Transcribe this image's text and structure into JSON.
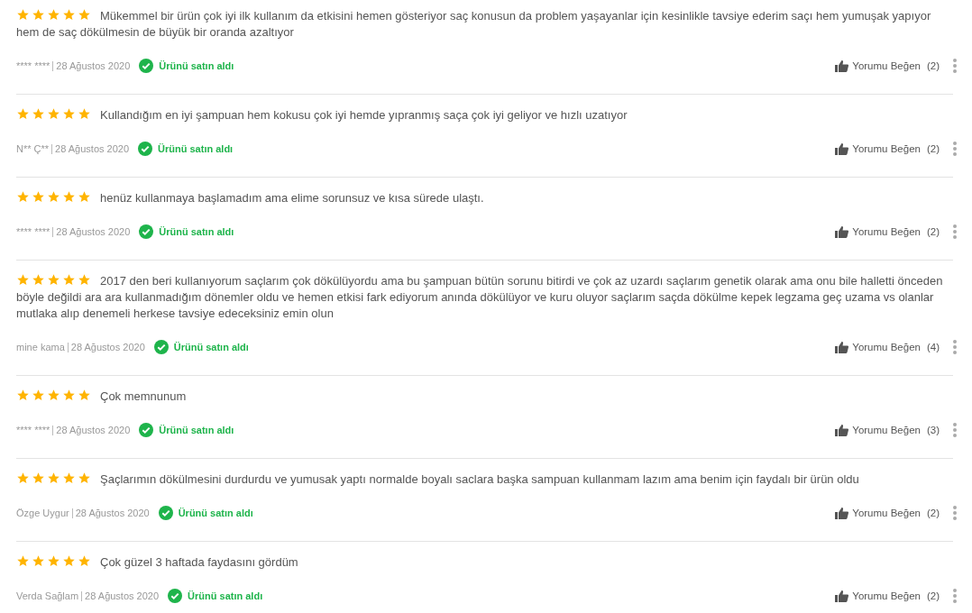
{
  "reviews": [
    {
      "stars": 5,
      "text": "Mükemmel bir ürün çok iyi ilk kullanım da etkisini hemen gösteriyor saç konusun da problem yaşayanlar için kesinlikle tavsiye ederim saçı hem yumuşak yapıyor hem de saç dökülmesin de büyük bir oranda azaltıyor",
      "author": "**** ****",
      "date": "28 Ağustos 2020",
      "verified": true,
      "badge": "Ürünü satın aldı",
      "like_label": "Yorumu Beğen",
      "like_count": "(2)"
    },
    {
      "stars": 5,
      "text": "Kullandığım en iyi şampuan hem kokusu çok iyi hemde yıpranmış saça çok iyi geliyor ve hızlı uzatıyor",
      "author": "N** Ç**",
      "date": "28 Ağustos 2020",
      "verified": true,
      "badge": "Ürünü satın aldı",
      "like_label": "Yorumu Beğen",
      "like_count": "(2)"
    },
    {
      "stars": 5,
      "text": "henüz kullanmaya başlamadım ama elime sorunsuz ve kısa sürede ulaştı.",
      "author": "**** ****",
      "date": "28 Ağustos 2020",
      "verified": true,
      "badge": "Ürünü satın aldı",
      "like_label": "Yorumu Beğen",
      "like_count": "(2)"
    },
    {
      "stars": 5,
      "text": "2017 den beri kullanıyorum saçlarım çok dökülüyordu ama bu şampuan bütün sorunu bitirdi ve çok az uzardı saçlarım genetik olarak ama onu bile halletti önceden böyle değildi ara ara kullanmadığım dönemler oldu ve hemen etkisi fark ediyorum anında dökülüyor ve kuru oluyor saçlarım saçda dökülme kepek legzama geç uzama vs olanlar mutlaka alıp denemeli herkese tavsiye edeceksiniz emin olun",
      "author": "mine kama",
      "date": "28 Ağustos 2020",
      "verified": true,
      "badge": "Ürünü satın aldı",
      "like_label": "Yorumu Beğen",
      "like_count": "(4)"
    },
    {
      "stars": 5,
      "text": "Çok memnunum",
      "author": "**** ****",
      "date": "28 Ağustos 2020",
      "verified": true,
      "badge": "Ürünü satın aldı",
      "like_label": "Yorumu Beğen",
      "like_count": "(3)"
    },
    {
      "stars": 5,
      "text": "Şaçlarımın dökülmesini durdurdu ve yumusak yaptı normalde boyalı saclara başka sampuan kullanmam lazım ama benim için faydalı bir ürün oldu",
      "author": "Özge Uygur",
      "date": "28 Ağustos 2020",
      "verified": true,
      "badge": "Ürünü satın aldı",
      "like_label": "Yorumu Beğen",
      "like_count": "(2)"
    },
    {
      "stars": 5,
      "text": "Çok güzel 3 haftada faydasını gördüm",
      "author": "Verda Sağlam",
      "date": "28 Ağustos 2020",
      "verified": true,
      "badge": "Ürünü satın aldı",
      "like_label": "Yorumu Beğen",
      "like_count": "(2)"
    }
  ]
}
